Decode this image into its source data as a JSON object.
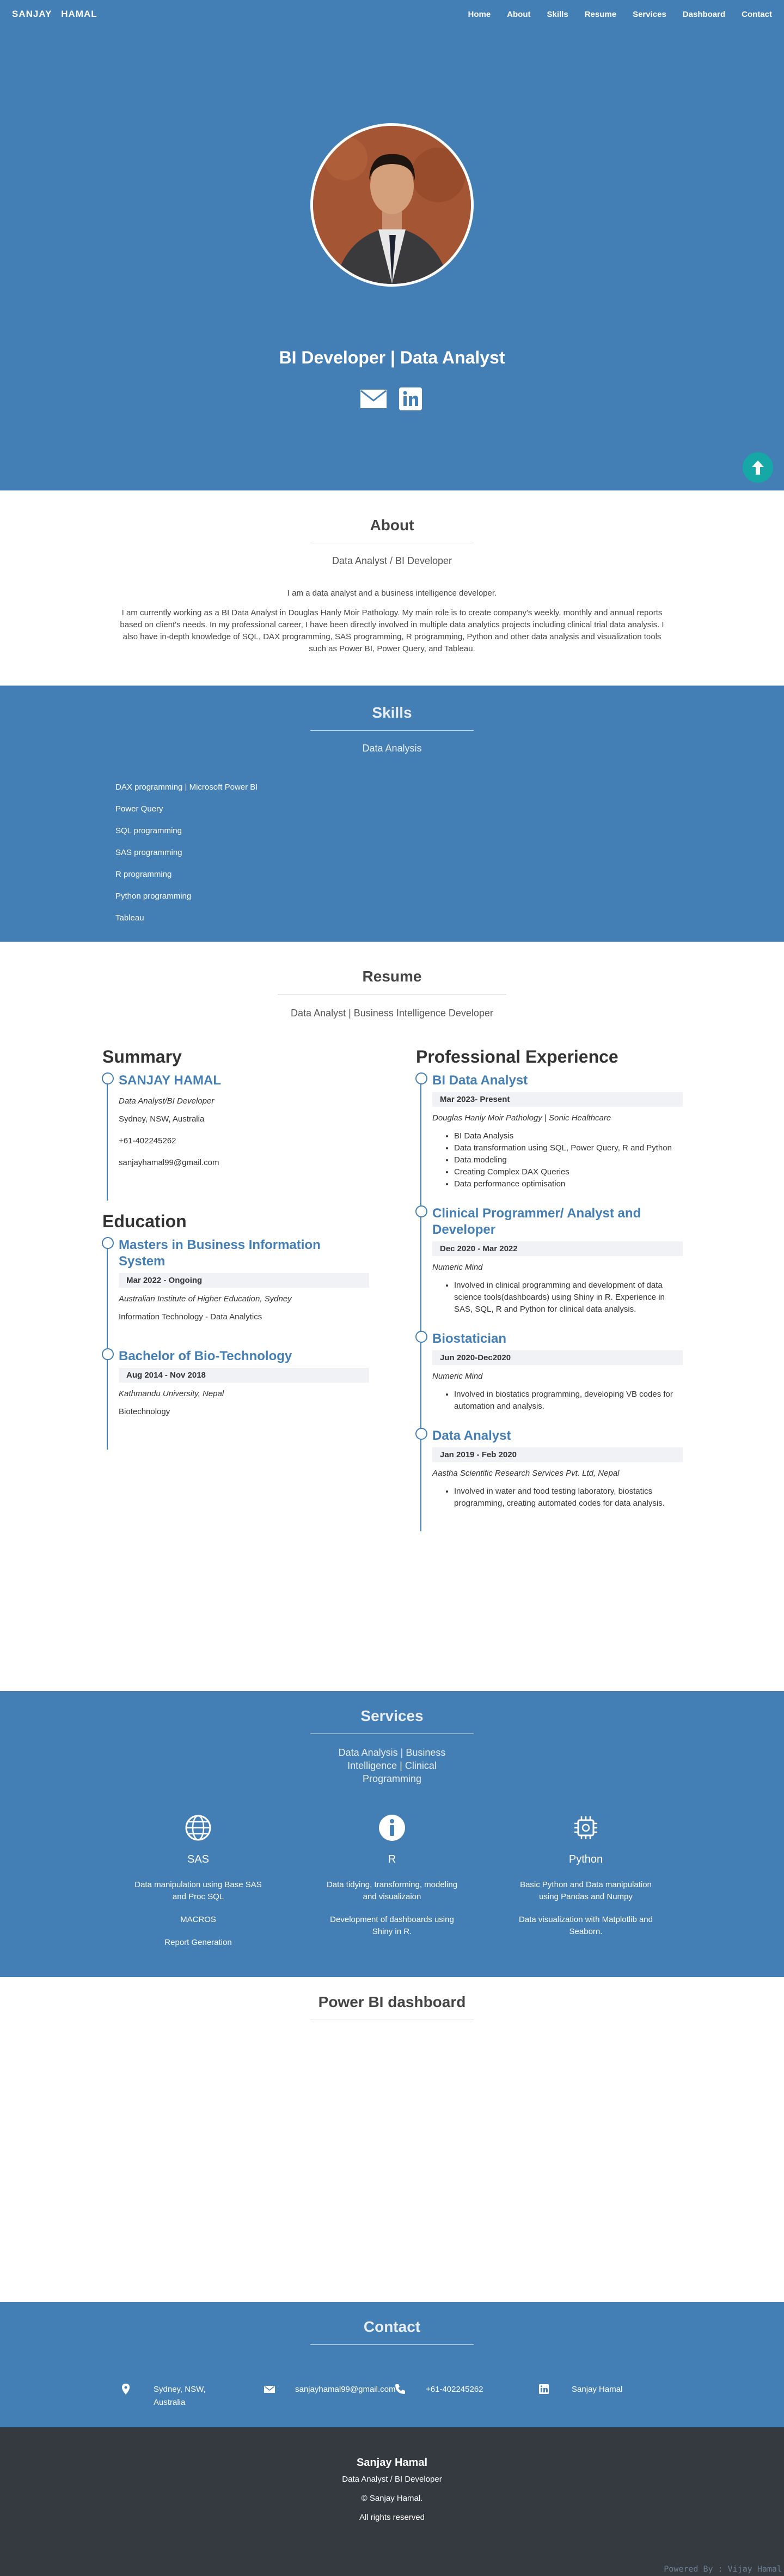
{
  "nav": {
    "brand_first": "Sanjay",
    "brand_last": "Hamal",
    "links": [
      "Home",
      "About",
      "Skills",
      "Resume",
      "Services",
      "Dashboard",
      "Contact"
    ]
  },
  "hero": {
    "title": "BI Developer | Data Analyst",
    "icons": [
      "email-icon",
      "linkedin-icon"
    ]
  },
  "about": {
    "title": "About",
    "subtitle": "Data Analyst / BI Developer",
    "intro": "I am a data analyst and a business intelligence developer.",
    "body": "I am currently working as a BI Data Analyst in Douglas Hanly Moir Pathology. My main role is to create company's weekly, monthly and annual reports based on client's needs. In my professional career, I have been directly involved in multiple data analytics projects including clinical trial data analysis. I also have in-depth knowledge of SQL, DAX programming, SAS programming, R programming, Python and other data analysis and visualization tools such as Power BI, Power Query, and Tableau."
  },
  "skills": {
    "title": "Skills",
    "subtitle": "Data Analysis",
    "items": [
      "DAX programming | Microsoft Power BI",
      "Power Query",
      "SQL programming",
      "SAS programming",
      "R programming",
      "Python programming",
      "Tableau"
    ]
  },
  "resume": {
    "title": "Resume",
    "subtitle": "Data Analyst | Business Intelligence Developer",
    "summary_heading": "Summary",
    "summary": {
      "name": "SANJAY HAMAL",
      "role": "Data Analyst/BI Developer",
      "location": "Sydney, NSW, Australia",
      "phone": "+61-402245262",
      "email": "sanjayhamal99@gmail.com"
    },
    "education_heading": "Education",
    "education": [
      {
        "title": "Masters in Business Information System",
        "date": "Mar 2022 - Ongoing",
        "org": "Australian Institute of Higher Education, Sydney",
        "detail": "Information Technology - Data Analytics"
      },
      {
        "title": "Bachelor of Bio-Technology",
        "date": "Aug 2014 - Nov 2018",
        "org": "Kathmandu University, Nepal",
        "detail": "Biotechnology"
      }
    ],
    "experience_heading": "Professional Experience",
    "experience": [
      {
        "title": "BI Data Analyst",
        "date": "Mar 2023- Present",
        "org": "Douglas Hanly Moir Pathology | Sonic Healthcare",
        "bullets": [
          "BI Data Analysis",
          "Data transformation using SQL, Power Query, R and Python",
          "Data modeling",
          "Creating Complex DAX Queries",
          "Data performance optimisation"
        ]
      },
      {
        "title": "Clinical Programmer/ Analyst and Developer",
        "date": "Dec 2020 - Mar 2022",
        "org": "Numeric Mind",
        "bullets": [
          "Involved in clinical programming and development of data science tools(dashboards) using Shiny in R. Experience in SAS, SQL, R and Python for clinical data analysis."
        ]
      },
      {
        "title": "Biostatician",
        "date": "Jun 2020-Dec2020",
        "org": "Numeric Mind",
        "bullets": [
          "Involved in biostatics programming, developing VB codes for automation and analysis."
        ]
      },
      {
        "title": "Data Analyst",
        "date": "Jan 2019 - Feb 2020",
        "org": "Aastha Scientific Research Services Pvt. Ltd, Nepal",
        "bullets": [
          "Involved in water and food testing laboratory, biostatics programming, creating automated codes for data analysis."
        ]
      }
    ]
  },
  "services": {
    "title": "Services",
    "subtitle": "Data Analysis | Business Intelligence | Clinical Programming",
    "items": [
      {
        "icon": "globe-icon",
        "name": "SAS",
        "lines": [
          "Data manipulation using Base SAS and Proc SQL",
          "MACROS",
          "Report Generation"
        ]
      },
      {
        "icon": "info-icon",
        "name": "R",
        "lines": [
          "Data tidying, transforming, modeling and visualizaion",
          "Development of dashboards using Shiny in R."
        ]
      },
      {
        "icon": "chip-icon",
        "name": "Python",
        "lines": [
          "Basic Python and Data manipulation using Pandas and Numpy",
          "Data visualization with Matplotlib and Seaborn."
        ]
      }
    ]
  },
  "dashboard": {
    "title": "Power BI dashboard"
  },
  "contact": {
    "title": "Contact",
    "items": [
      {
        "icon": "location-icon",
        "text": "Sydney, NSW, Australia"
      },
      {
        "icon": "email-icon",
        "text": "sanjayhamal99@gmail.com"
      },
      {
        "icon": "phone-icon",
        "text": "+61-402245262"
      },
      {
        "icon": "linkedin-icon",
        "text": "Sanjay Hamal"
      }
    ]
  },
  "footer": {
    "name": "Sanjay Hamal",
    "role": "Data Analyst / BI Developer",
    "copyright": "© Sanjay Hamal.",
    "rights": "All rights reserved",
    "powered": "Powered By : Vijay Hamal"
  },
  "colors": {
    "primary": "#437eb4",
    "accent": "#16a8a6",
    "footer": "#343a40"
  }
}
